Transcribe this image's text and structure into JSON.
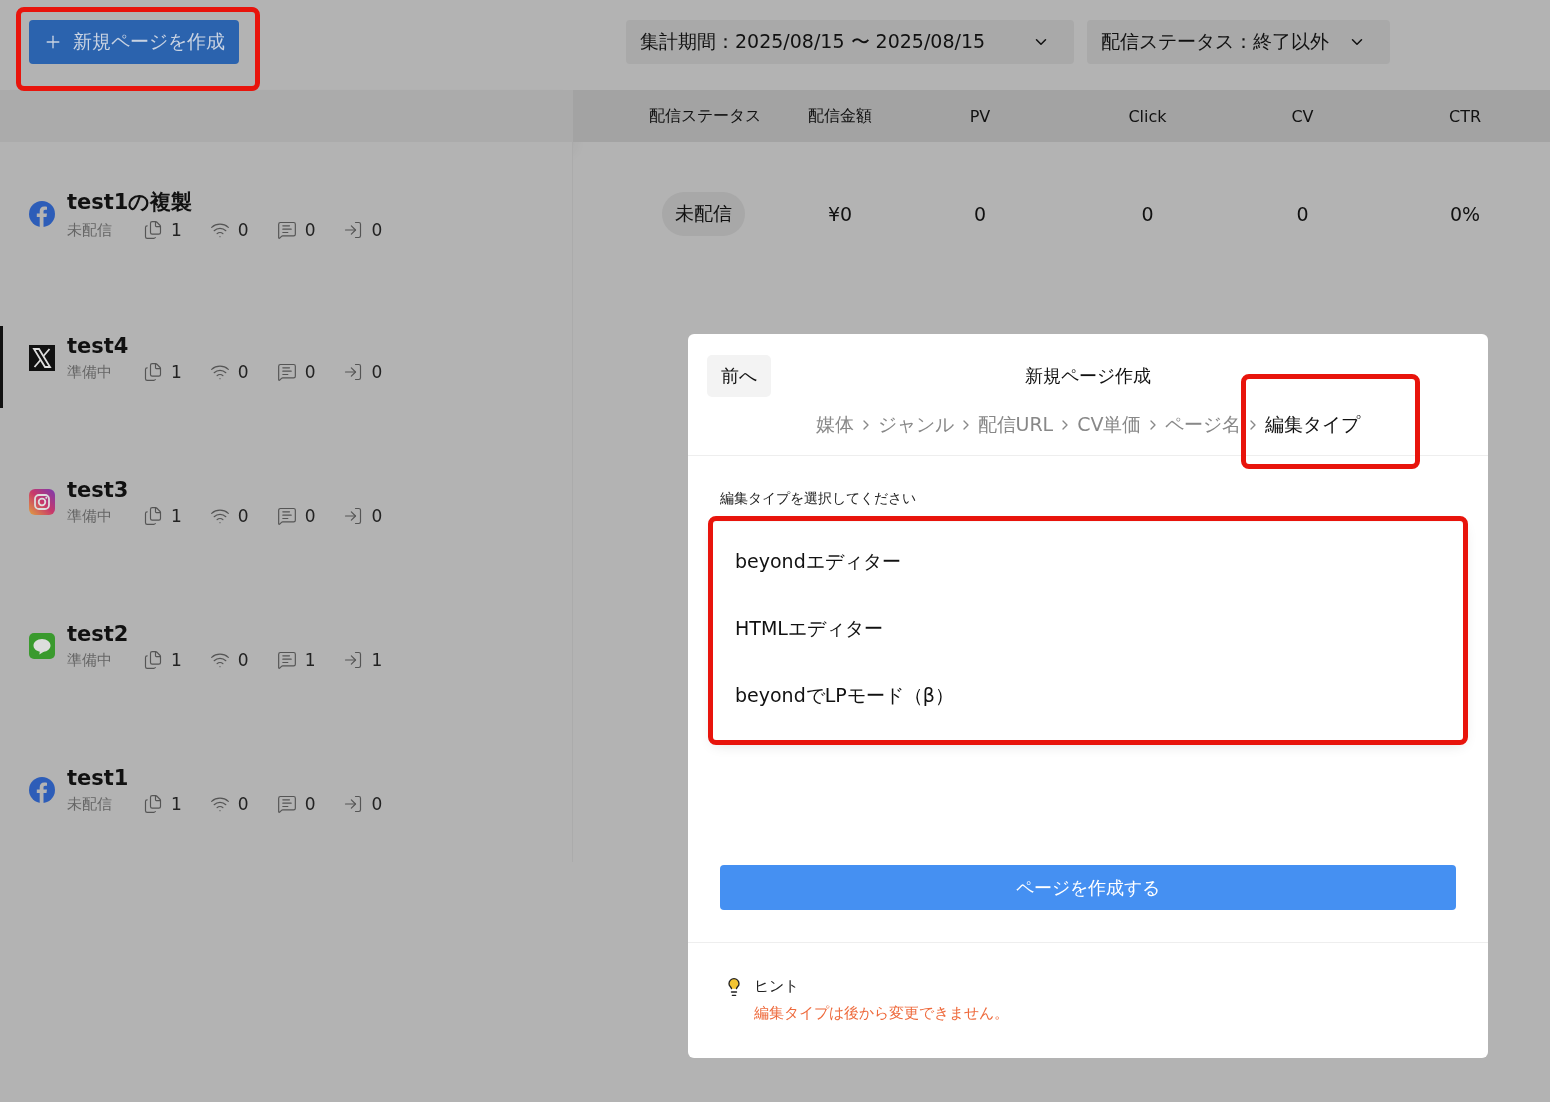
{
  "toolbar": {
    "create_button": {
      "label": "新規ページを作成",
      "highlighted": true
    },
    "filters": [
      {
        "label": "集計期間：2025/08/15 〜 2025/08/15"
      },
      {
        "label": "配信ステータス：終了以外"
      }
    ]
  },
  "table": {
    "columns": [
      "配信ステータス",
      "配信金額",
      "PV",
      "Click",
      "CV",
      "CTR"
    ],
    "rows": [
      {
        "name": "test1の複製",
        "kind": "facebook",
        "status": "未配信",
        "stats": [
          "1",
          "0",
          "0",
          "0"
        ],
        "selected": false,
        "cells": [
          "未配信",
          "¥0",
          "0",
          "0",
          "0",
          "0%"
        ]
      },
      {
        "name": "test4",
        "kind": "x",
        "status": "準備中",
        "stats": [
          "1",
          "0",
          "0",
          "0"
        ],
        "selected": true
      },
      {
        "name": "test3",
        "kind": "instagram",
        "status": "準備中",
        "stats": [
          "1",
          "0",
          "0",
          "0"
        ],
        "selected": false
      },
      {
        "name": "test2",
        "kind": "line",
        "status": "準備中",
        "stats": [
          "1",
          "0",
          "1",
          "1"
        ],
        "selected": false
      },
      {
        "name": "test1",
        "kind": "facebook",
        "status": "未配信",
        "stats": [
          "1",
          "0",
          "0",
          "0"
        ],
        "selected": false
      }
    ]
  },
  "modal": {
    "back_button": "前へ",
    "title": "新規ページ作成",
    "steps": [
      {
        "label": "媒体",
        "current": false,
        "highlighted": false
      },
      {
        "label": "ジャンル",
        "current": false,
        "highlighted": false
      },
      {
        "label": "配信URL",
        "current": false,
        "highlighted": false
      },
      {
        "label": "CV単価",
        "current": false,
        "highlighted": false
      },
      {
        "label": "ページ名",
        "current": false,
        "highlighted": false
      },
      {
        "label": "編集タイプ",
        "current": true,
        "highlighted": true
      }
    ],
    "prompt": "編集タイプを選択してください",
    "options_highlighted": true,
    "options": [
      "beyondエディター",
      "HTMLエディター",
      "beyondでLPモード（β）"
    ],
    "submit_button": "ページを作成する",
    "hint": {
      "title": "ヒント",
      "text": "編集タイプは後から変更できません。"
    }
  }
}
